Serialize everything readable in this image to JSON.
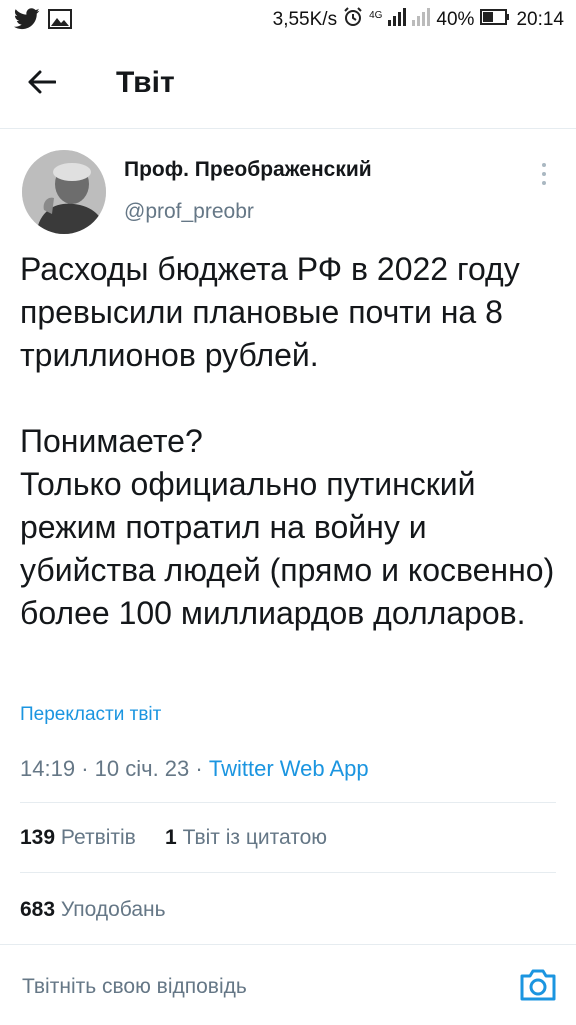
{
  "status_bar": {
    "net_speed": "3,55K/s",
    "network_type": "4G",
    "battery": "40%",
    "time": "20:14",
    "icons": [
      "twitter-icon",
      "image-icon",
      "alarm-icon",
      "signal-icon",
      "signal-empty-icon",
      "battery-icon"
    ]
  },
  "header": {
    "title": "Твіт",
    "back_icon": "arrow-left-icon"
  },
  "tweet": {
    "author_name": "Проф. Преображенский",
    "author_handle": "@prof_preobr",
    "text": "Расходы бюджета РФ в 2022 году превысили плановые почти на 8 триллионов рублей.\n\nПонимаете?\nТолько официально путинский режим потратил на войну и убийства людей (прямо и косвенно) более 100 миллиардов долларов.",
    "translate_label": "Перекласти твіт",
    "time": "14:19",
    "date": "10 січ. 23",
    "app": "Twitter Web App",
    "separator": "·"
  },
  "stats": {
    "retweets_count": "139",
    "retweets_label": "Ретвітів",
    "quotes_count": "1",
    "quotes_label": "Твіт із цитатою",
    "likes_count": "683",
    "likes_label": "Уподобань"
  },
  "reply": {
    "placeholder": "Твітніть свою відповідь",
    "camera_icon": "camera-icon"
  },
  "colors": {
    "accent": "#1b95e0",
    "text": "#14171a",
    "secondary": "#657786",
    "divider": "#e6ecf0"
  }
}
